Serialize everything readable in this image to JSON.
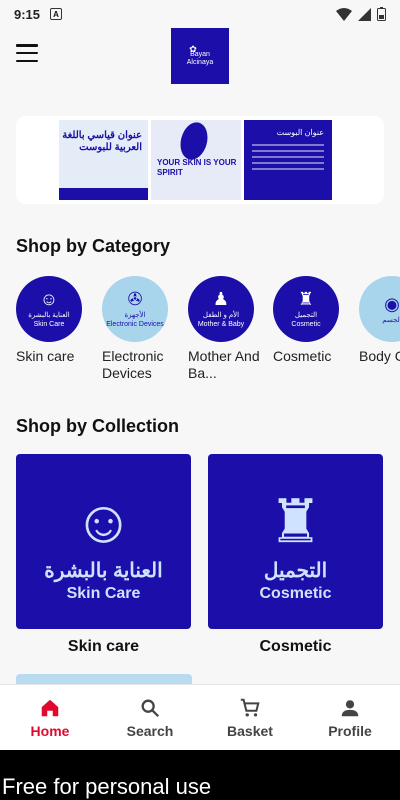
{
  "status_bar": {
    "time": "9:15",
    "notification_letter": "A"
  },
  "app_bar": {
    "logo_line1": "Bayan",
    "logo_line2": "Alcinaya"
  },
  "banner": {
    "card_a_title": "عنوان قياسي باللغة العربية للبوست",
    "card_b_slogan": "YOUR SKIN IS YOUR SPIRIT",
    "card_c_title": "عنوان البوست"
  },
  "shop_by_category": {
    "title": "Shop by Category",
    "items": [
      {
        "label": "Skin care",
        "ar": "العناية بالبشرة",
        "en": "Skin Care",
        "icon": "face-icon",
        "color": "#1c0ea8"
      },
      {
        "label": "Electronic Devices",
        "ar": "الأجهزة",
        "en": "Electronic Devices",
        "icon": "hairdryer-icon",
        "color": "#a8d4ec"
      },
      {
        "label": "Mother And Ba...",
        "ar": "الأم و الطفل",
        "en": "Mother & Baby",
        "icon": "bottle-icon",
        "color": "#1c0ea8"
      },
      {
        "label": "Cosmetic",
        "ar": "التجميل",
        "en": "Cosmetic",
        "icon": "makeup-icon",
        "color": "#1c0ea8"
      },
      {
        "label": "Body Care",
        "ar": "الجسم",
        "en": "",
        "icon": "body-icon",
        "color": "#a8d4ec"
      }
    ]
  },
  "shop_by_collection": {
    "title": "Shop by Collection",
    "items": [
      {
        "label": "Skin care",
        "ar": "العناية بالبشرة",
        "en": "Skin Care"
      },
      {
        "label": "Cosmetic",
        "ar": "التجميل",
        "en": "Cosmetic"
      }
    ]
  },
  "bottom_nav": {
    "items": [
      {
        "label": "Home",
        "icon": "home-icon",
        "active": true
      },
      {
        "label": "Search",
        "icon": "search-icon"
      },
      {
        "label": "Basket",
        "icon": "cart-icon"
      },
      {
        "label": "Profile",
        "icon": "person-icon"
      }
    ]
  },
  "footer": {
    "text": "Free for personal use"
  },
  "colors": {
    "brand": "#1c0ea8",
    "light_blue": "#a8d4ec",
    "active": "#e0092d"
  }
}
